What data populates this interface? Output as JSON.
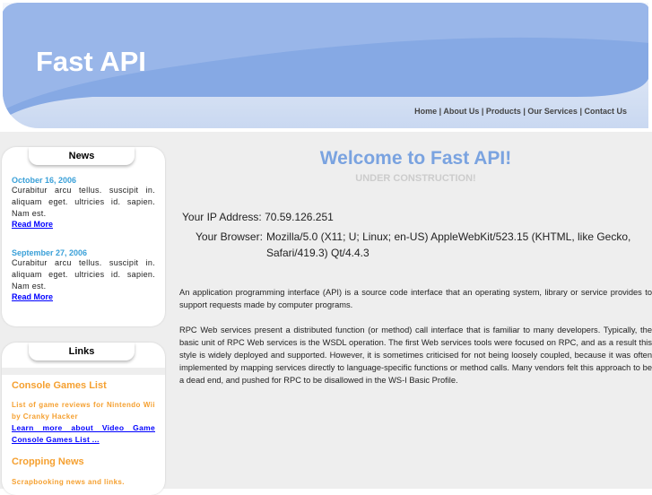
{
  "header": {
    "title": "Fast API",
    "nav": [
      "Home",
      "About Us",
      "Products",
      "Our Services",
      "Contact Us"
    ]
  },
  "news": {
    "title": "News",
    "items": [
      {
        "date": "October 16, 2006",
        "text": "Curabitur arcu tellus. suscipit in. aliquam eget. ultricies id. sapien. Nam est.",
        "link": "Read More"
      },
      {
        "date": "September 27, 2006",
        "text": "Curabitur arcu tellus. suscipit in. aliquam eget. ultricies id. sapien. Nam est.",
        "link": "Read More"
      }
    ]
  },
  "links": {
    "title": "Links",
    "items": [
      {
        "title": "Console Games List",
        "text": "List of game reviews for Nintendo Wii by Cranky Hacker",
        "link": "Learn more about Video Game Console Games List ..."
      },
      {
        "title": "Cropping News",
        "text": "Scrapbooking news and links."
      }
    ]
  },
  "main": {
    "heading": "Welcome to Fast API!",
    "subheading": "UNDER CONSTRUCTION!",
    "ip_label": "Your IP Address:",
    "ip": "70.59.126.251",
    "browser_label": "Your Browser:",
    "browser": "Mozilla/5.0 (X11; U; Linux; en-US) AppleWebKit/523.15 (KHTML, like Gecko, Safari/419.3) Qt/4.4.3",
    "paragraphs": [
      "An application programming interface (API) is a source code interface that an operating system, library or service provides to support requests made by computer programs.",
      "RPC Web services present a distributed function (or method) call interface that is familiar to many developers. Typically, the basic unit of RPC Web services is the WSDL operation. The first Web services tools were focused on RPC, and as a result this style is widely deployed and supported. However, it is sometimes criticised for not being loosely coupled, because it was often implemented by mapping services directly to language-specific functions or method calls. Many vendors felt this approach to be a dead end, and pushed for RPC to be disallowed in the WS-I Basic Profile."
    ]
  }
}
